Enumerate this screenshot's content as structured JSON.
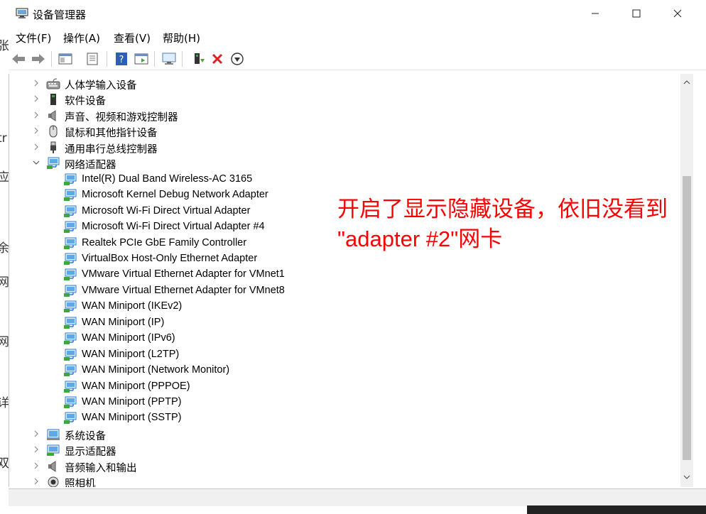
{
  "window": {
    "title": "设备管理器"
  },
  "window_controls": {
    "minimize": "—",
    "maximize": "☐",
    "close": "✕"
  },
  "menu": [
    "文件(F)",
    "操作(A)",
    "查看(V)",
    "帮助(H)"
  ],
  "toolbar": [
    "back-icon",
    "forward-icon",
    "properties-view-icon",
    "show-hide-icon",
    "help-icon",
    "action-pane-icon",
    "monitor-icon",
    "update-driver-icon",
    "uninstall-icon",
    "download-icon"
  ],
  "tree": [
    {
      "label": "人体学输入设备",
      "icon": "hid-icon",
      "level": 0,
      "expanded": false
    },
    {
      "label": "软件设备",
      "icon": "software-device-icon",
      "level": 0,
      "expanded": false
    },
    {
      "label": "声音、视频和游戏控制器",
      "icon": "speaker-icon",
      "level": 0,
      "expanded": false
    },
    {
      "label": "鼠标和其他指针设备",
      "icon": "mouse-icon",
      "level": 0,
      "expanded": false
    },
    {
      "label": "通用串行总线控制器",
      "icon": "usb-icon",
      "level": 0,
      "expanded": false
    },
    {
      "label": "网络适配器",
      "icon": "network-icon",
      "level": 0,
      "expanded": true
    },
    {
      "label": "Intel(R) Dual Band Wireless-AC 3165",
      "icon": "network-icon",
      "level": 1
    },
    {
      "label": "Microsoft Kernel Debug Network Adapter",
      "icon": "network-icon",
      "level": 1
    },
    {
      "label": "Microsoft Wi-Fi Direct Virtual Adapter",
      "icon": "network-icon",
      "level": 1
    },
    {
      "label": "Microsoft Wi-Fi Direct Virtual Adapter #4",
      "icon": "network-icon",
      "level": 1
    },
    {
      "label": "Realtek PCIe GbE Family Controller",
      "icon": "network-icon",
      "level": 1
    },
    {
      "label": "VirtualBox Host-Only Ethernet Adapter",
      "icon": "network-icon",
      "level": 1
    },
    {
      "label": "VMware Virtual Ethernet Adapter for VMnet1",
      "icon": "network-icon",
      "level": 1
    },
    {
      "label": "VMware Virtual Ethernet Adapter for VMnet8",
      "icon": "network-icon",
      "level": 1
    },
    {
      "label": "WAN Miniport (IKEv2)",
      "icon": "network-icon",
      "level": 1
    },
    {
      "label": "WAN Miniport (IP)",
      "icon": "network-icon",
      "level": 1
    },
    {
      "label": "WAN Miniport (IPv6)",
      "icon": "network-icon",
      "level": 1
    },
    {
      "label": "WAN Miniport (L2TP)",
      "icon": "network-icon",
      "level": 1
    },
    {
      "label": "WAN Miniport (Network Monitor)",
      "icon": "network-icon",
      "level": 1
    },
    {
      "label": "WAN Miniport (PPPOE)",
      "icon": "network-icon",
      "level": 1
    },
    {
      "label": "WAN Miniport (PPTP)",
      "icon": "network-icon",
      "level": 1
    },
    {
      "label": "WAN Miniport (SSTP)",
      "icon": "network-icon",
      "level": 1
    },
    {
      "label": "系统设备",
      "icon": "system-device-icon",
      "level": 0,
      "expanded": false
    },
    {
      "label": "显示适配器",
      "icon": "display-adapter-icon",
      "level": 0,
      "expanded": false
    },
    {
      "label": "音频输入和输出",
      "icon": "speaker-icon",
      "level": 0,
      "expanded": false
    },
    {
      "label": "照相机",
      "icon": "camera-icon",
      "level": 0,
      "expanded": false
    }
  ],
  "annotation": {
    "line1": "开启了显示隐藏设备，依旧没看到",
    "line2": "\"adapter #2\"网卡"
  },
  "background_peek": [
    "张",
    "tr",
    "应",
    "余",
    "网",
    "网",
    "详",
    "双"
  ],
  "colors": {
    "annotation": "#ff0000",
    "icon_blue": "#2e7bcf",
    "icon_green": "#3aa935"
  }
}
